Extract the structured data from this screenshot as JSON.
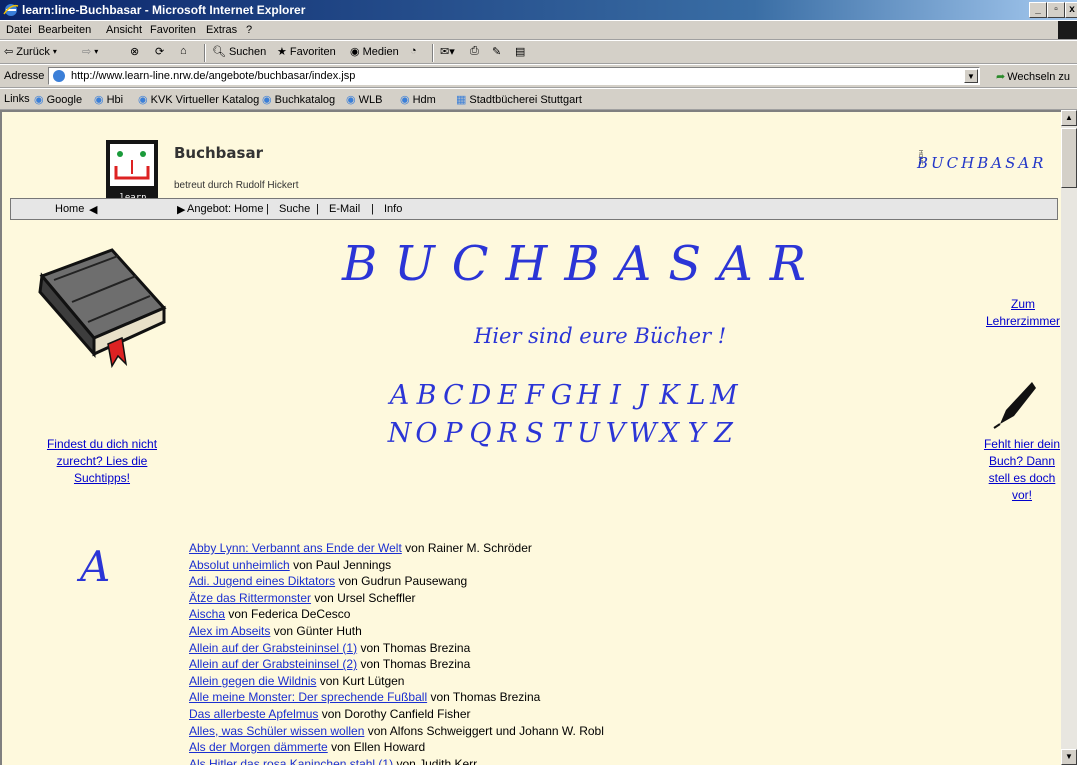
{
  "window": {
    "title": "learn:line-Buchbasar - Microsoft Internet Explorer"
  },
  "menu": [
    "Datei",
    "Bearbeiten",
    "Ansicht",
    "Favoriten",
    "Extras",
    "?"
  ],
  "toolbar": {
    "back": "Zurück",
    "search": "Suchen",
    "favorites": "Favoriten",
    "media": "Medien"
  },
  "address": {
    "label": "Adresse",
    "url": "http://www.learn-line.nrw.de/angebote/buchbasar/index.jsp",
    "go": "Wechseln zu"
  },
  "links": {
    "label": "Links",
    "items": [
      "Google",
      "Hbi",
      "KVK Virtueller Katalog",
      "Buchkatalog",
      "WLB",
      "Hdm",
      "Stadtbücherei Stuttgart"
    ]
  },
  "site": {
    "title": "Buchbasar",
    "subtitle": "betreut durch Rudolf Hickert",
    "logo_text": "learn :line",
    "side_logo": "BUCHBASAR",
    "side_home": "HOME"
  },
  "nav": {
    "home": "Home",
    "angebot": "Angebot: Home",
    "suche": "Suche",
    "email": "E-Mail",
    "info": "Info",
    "separator": "|"
  },
  "page": {
    "heading": "BUCHBASAR",
    "subheading": "Hier sind eure Bücher !",
    "letters_row1": [
      "A",
      "B",
      "C",
      "D",
      "E",
      "F",
      "G",
      "H",
      "I",
      "J",
      "K",
      "L",
      "M"
    ],
    "letters_row2": [
      "N",
      "O",
      "P",
      "Q",
      "R",
      "S",
      "T",
      "U",
      "V",
      "W",
      "X",
      "Y",
      "Z"
    ],
    "teacher_link": "Zum Lehrerzimmer",
    "tips_link": "Findest du dich nicht zurecht? Lies die Suchtipps!",
    "missing_link": "Fehlt hier dein Buch? Dann stell es doch vor!",
    "section_letter": "A"
  },
  "books": [
    {
      "title": "Abby Lynn: Verbannt ans Ende der Welt",
      "author": "von Rainer M. Schröder"
    },
    {
      "title": "Absolut unheimlich",
      "author": "von Paul Jennings"
    },
    {
      "title": "Adi. Jugend eines Diktators",
      "author": "von Gudrun Pausewang"
    },
    {
      "title": "Ätze das Rittermonster",
      "author": "von Ursel Scheffler"
    },
    {
      "title": "Aischa",
      "author": "von Federica DeCesco"
    },
    {
      "title": "Alex im Abseits",
      "author": "von Günter Huth"
    },
    {
      "title": "Allein auf der Grabsteininsel (1)",
      "author": "von Thomas Brezina"
    },
    {
      "title": "Allein auf der Grabsteininsel (2)",
      "author": "von Thomas Brezina"
    },
    {
      "title": "Allein gegen die Wildnis",
      "author": "von Kurt Lütgen"
    },
    {
      "title": "Alle meine Monster: Der sprechende Fußball",
      "author": "von Thomas Brezina"
    },
    {
      "title": "Das allerbeste Apfelmus",
      "author": "von Dorothy Canfield Fisher"
    },
    {
      "title": "Alles, was Schüler wissen wollen",
      "author": "von Alfons Schweiggert und Johann W. Robl"
    },
    {
      "title": "Als der Morgen dämmerte",
      "author": "von Ellen Howard"
    },
    {
      "title": "Als Hitler das rosa Kaninchen stahl (1)",
      "author": "von Judith Kerr"
    }
  ]
}
